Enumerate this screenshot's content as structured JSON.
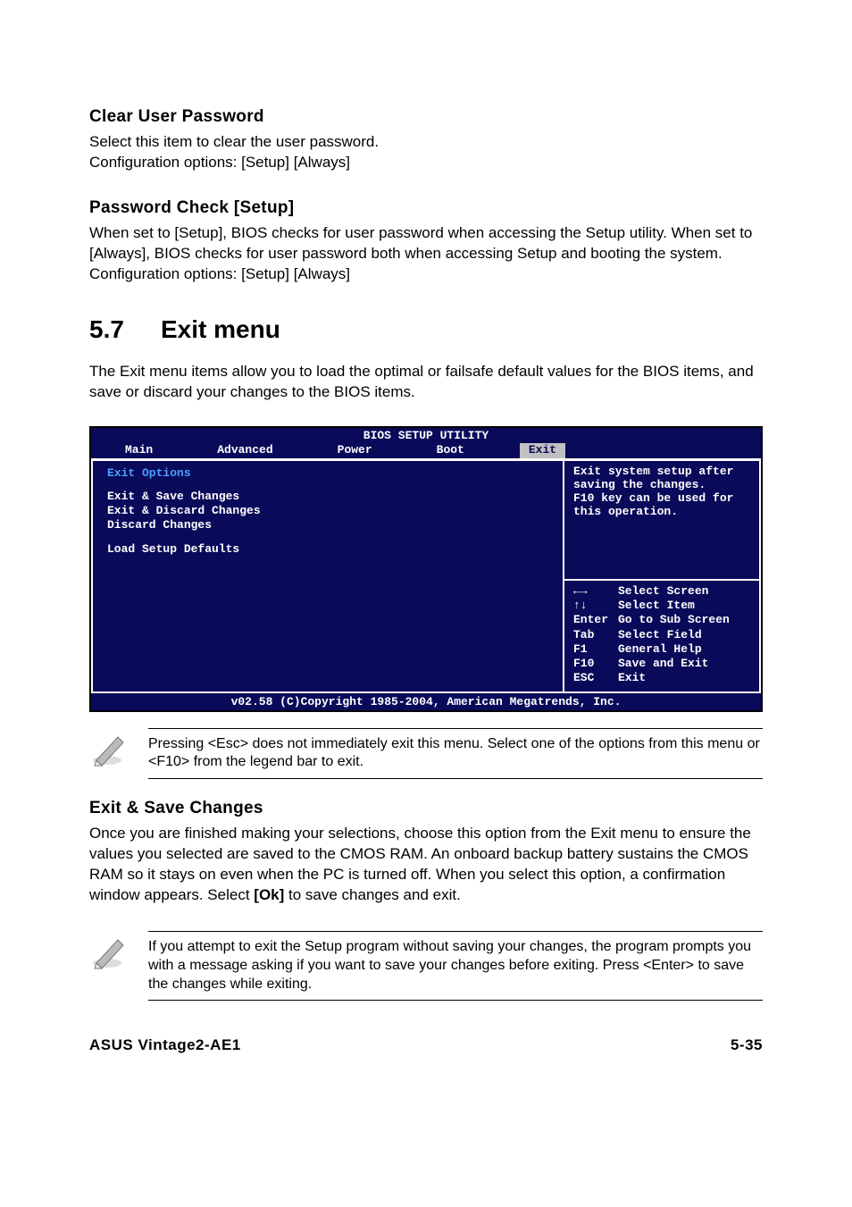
{
  "clear_user": {
    "title": "Clear User Password",
    "text": "Select this item to clear the user password.\nConfiguration options: [Setup] [Always]"
  },
  "pwd_check": {
    "title": "Password Check [Setup]",
    "text": "When set to [Setup], BIOS checks for user password when accessing the Setup utility. When set to [Always], BIOS checks for user password both when accessing Setup and booting the system.\nConfiguration options: [Setup] [Always]"
  },
  "section": {
    "num": "5.7",
    "title": "Exit menu",
    "intro": "The Exit menu items allow you to load the optimal or failsafe default values for the BIOS items, and save or discard your changes to the BIOS items."
  },
  "bios": {
    "title": "BIOS SETUP UTILITY",
    "tabs": [
      "Main",
      "Advanced",
      "Power",
      "Boot",
      "Exit"
    ],
    "selected_tab": "Exit",
    "left_header": "Exit Options",
    "items": [
      "Exit & Save Changes",
      "Exit & Discard Changes",
      "Discard Changes"
    ],
    "items2": [
      "Load Setup Defaults"
    ],
    "help_text": "Exit system setup after saving the changes.\nF10 key can be used for this operation.",
    "legend": [
      {
        "key": "←→",
        "desc": "Select Screen"
      },
      {
        "key": "↑↓",
        "desc": "Select Item"
      },
      {
        "key": "Enter",
        "desc": "Go to Sub Screen"
      },
      {
        "key": "Tab",
        "desc": "Select Field"
      },
      {
        "key": "F1",
        "desc": "General Help"
      },
      {
        "key": "F10",
        "desc": "Save and Exit"
      },
      {
        "key": "ESC",
        "desc": "Exit"
      }
    ],
    "footer": "v02.58 (C)Copyright 1985-2004, American Megatrends, Inc."
  },
  "note1": "Pressing <Esc> does not immediately exit this menu. Select one of the options from this menu or <F10> from the legend bar to exit.",
  "exit_save": {
    "title": "Exit & Save Changes",
    "text_pre": "Once you are finished making your selections, choose this option from the Exit menu to ensure the values you selected are saved to the CMOS RAM. An onboard backup battery sustains the CMOS RAM so it stays on even when the PC is turned off. When you select this option, a confirmation window appears. Select ",
    "ok": "[Ok]",
    "text_post": " to save changes and exit."
  },
  "note2": "If you attempt to exit the Setup program without saving your changes, the program prompts you with a message asking if you want to save your changes before exiting. Press <Enter>  to save the  changes while exiting.",
  "footer": {
    "left": "ASUS Vintage2-AE1",
    "right": "5-35"
  }
}
